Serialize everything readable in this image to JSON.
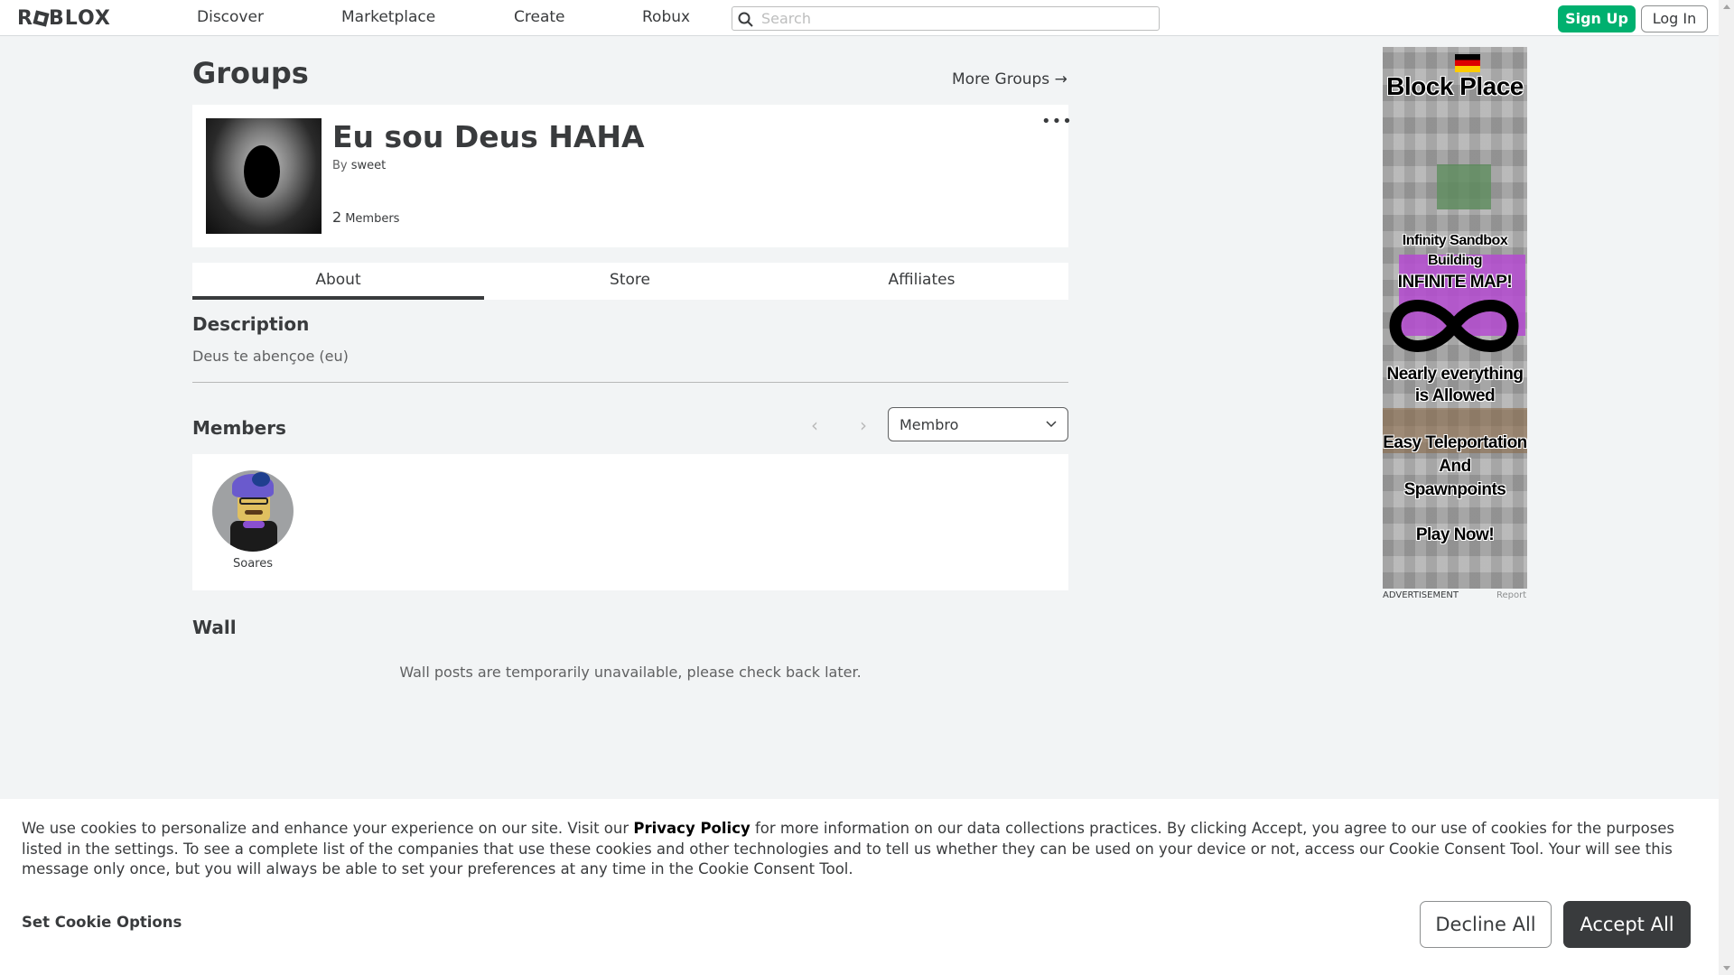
{
  "nav": {
    "logo": "ROBLOX",
    "links": [
      "Discover",
      "Marketplace",
      "Create",
      "Robux"
    ],
    "search_placeholder": "Search",
    "signup_label": "Sign Up",
    "login_label": "Log In"
  },
  "page": {
    "title": "Groups",
    "more_groups": "More Groups →"
  },
  "group": {
    "name": "Eu sou Deus HAHA",
    "by_label": "By",
    "owner": "sweet",
    "member_count": "2",
    "members_label": "Members",
    "menu": "•••"
  },
  "tabs": [
    "About",
    "Store",
    "Affiliates"
  ],
  "about": {
    "description_heading": "Description",
    "description": "Deus te abençoe (eu)",
    "members_heading": "Members",
    "role_selected": "Membro",
    "members": [
      {
        "name": "Soares"
      }
    ],
    "wall_heading": "Wall",
    "wall_message": "Wall posts are temporarily unavailable, please check back later."
  },
  "ad": {
    "lines": [
      "Block Place",
      "Infinity Sandbox",
      "Building",
      "INFINITE MAP!",
      "Nearly everything",
      "is Allowed",
      "Easy Teleportation",
      "And",
      "Spawnpoints",
      "Play Now!"
    ],
    "label": "ADVERTISEMENT",
    "report": "Report"
  },
  "cookie": {
    "text_before": "We use cookies to personalize and enhance your experience on our site. Visit our ",
    "privacy_link": "Privacy Policy",
    "text_after": " for more information on our data collections practices. By clicking Accept, you agree to our use of cookies for the purposes listed in the settings. To see a complete list of the companies that use these cookies and other technologies and to tell us whether they can be used on your device or not, access our Cookie Consent Tool. Your will see this message only once, but you will always be able to set your preferences at any time in the Cookie Consent Tool.",
    "options_label": "Set Cookie Options",
    "decline_label": "Decline All",
    "accept_label": "Accept All"
  },
  "colors": {
    "accent_green": "#00b06f",
    "text_dark": "#393b3d",
    "background": "#f2f4f5"
  }
}
